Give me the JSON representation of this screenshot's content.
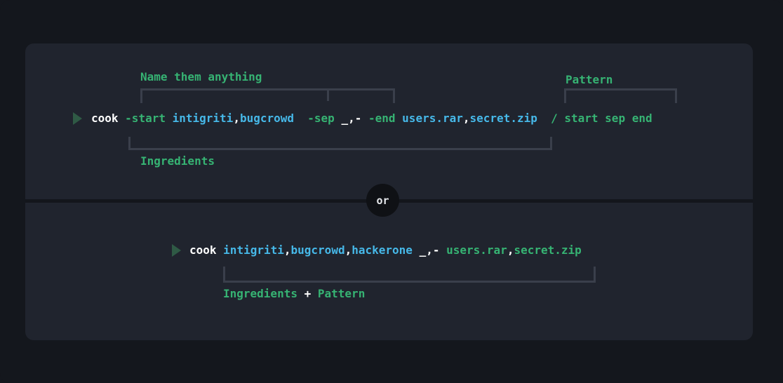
{
  "section1": {
    "label_names": "Name them anything",
    "label_pattern": "Pattern",
    "label_ingredients": "Ingredients",
    "command": {
      "cmd": "cook",
      "flag_start": "-start",
      "val_start_a": "intigriti",
      "comma1": ",",
      "val_start_b": "bugcrowd",
      "flag_sep": "-sep",
      "val_sep": "_,-",
      "flag_end": "-end",
      "val_end_a": "users.rar",
      "comma2": ",",
      "val_end_b": "secret.zip",
      "pattern": "/ start sep end"
    }
  },
  "divider": {
    "or_label": "or"
  },
  "section2": {
    "command": {
      "cmd": "cook",
      "val_a": "intigriti",
      "comma1": ",",
      "val_b": "bugcrowd",
      "comma2": ",",
      "val_c": "hackerone",
      "sep": "_,-",
      "val_d": "users.rar",
      "comma3": ",",
      "val_e": "secret.zip"
    },
    "label_ingredients": "Ingredients",
    "label_plus": "+",
    "label_pattern": "Pattern"
  }
}
